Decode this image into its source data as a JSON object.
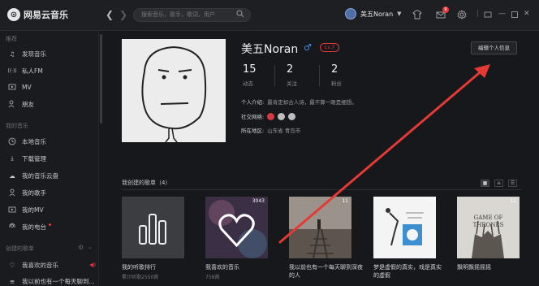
{
  "app": {
    "name": "网易云音乐"
  },
  "search": {
    "placeholder": "搜索音乐，歌手，歌词，用户"
  },
  "header_user": {
    "name": "美五Noran",
    "msg_count": "9"
  },
  "sidebar": {
    "section_recommend": "推荐",
    "recommend_items": [
      {
        "label": "发现音乐",
        "icon": "music-note-icon"
      },
      {
        "label": "私人FM",
        "icon": "radio-icon"
      },
      {
        "label": "MV",
        "icon": "mv-icon"
      },
      {
        "label": "朋友",
        "icon": "friends-icon"
      }
    ],
    "section_my_music": "我的音乐",
    "my_music_items": [
      {
        "label": "本地音乐",
        "icon": "local-music-icon"
      },
      {
        "label": "下载管理",
        "icon": "download-icon"
      },
      {
        "label": "我的音乐云盘",
        "icon": "cloud-icon"
      },
      {
        "label": "我的歌手",
        "icon": "singer-icon"
      },
      {
        "label": "我的MV",
        "icon": "my-mv-icon"
      },
      {
        "label": "我的电台",
        "icon": "podcast-icon"
      }
    ],
    "section_created": "创建的歌单",
    "created_items": [
      {
        "label": "我喜欢的音乐",
        "icon": "heart-icon"
      },
      {
        "label": "我以前也有一个每天聊到...",
        "icon": "playlist-icon"
      }
    ]
  },
  "profile": {
    "name": "美五Noran",
    "level": "Lv.7",
    "edit_label": "编辑个人信息",
    "stats": [
      {
        "value": "15",
        "label": "动态"
      },
      {
        "value": "2",
        "label": "关注"
      },
      {
        "value": "2",
        "label": "粉丝"
      }
    ],
    "bio_label": "个人介绍:",
    "bio": "最肯定却古人诗，最不算一眼是细想。",
    "social_label": "社交网络:",
    "region_label": "所在地区:",
    "region": "山东省 青岛市"
  },
  "playlists": {
    "header": "我创建的歌单（4）",
    "cards": [
      {
        "title": "我的听歌排行",
        "sub": "累计听歌2550首",
        "count": ""
      },
      {
        "title": "我喜欢的音乐",
        "sub": "758首",
        "count": "3043"
      },
      {
        "title": "我以前也有一个每天聊到深夜的人",
        "sub": "",
        "count": "11"
      },
      {
        "title": "梦是虚假的真实，戏是真实的虚假",
        "sub": "",
        "count": "11"
      },
      {
        "title": "飘明飘摇摇摇",
        "sub": "",
        "count": "11"
      }
    ]
  },
  "colors": {
    "accent": "#e0383e",
    "arrow": "#e53935",
    "bg": "#16181c"
  }
}
